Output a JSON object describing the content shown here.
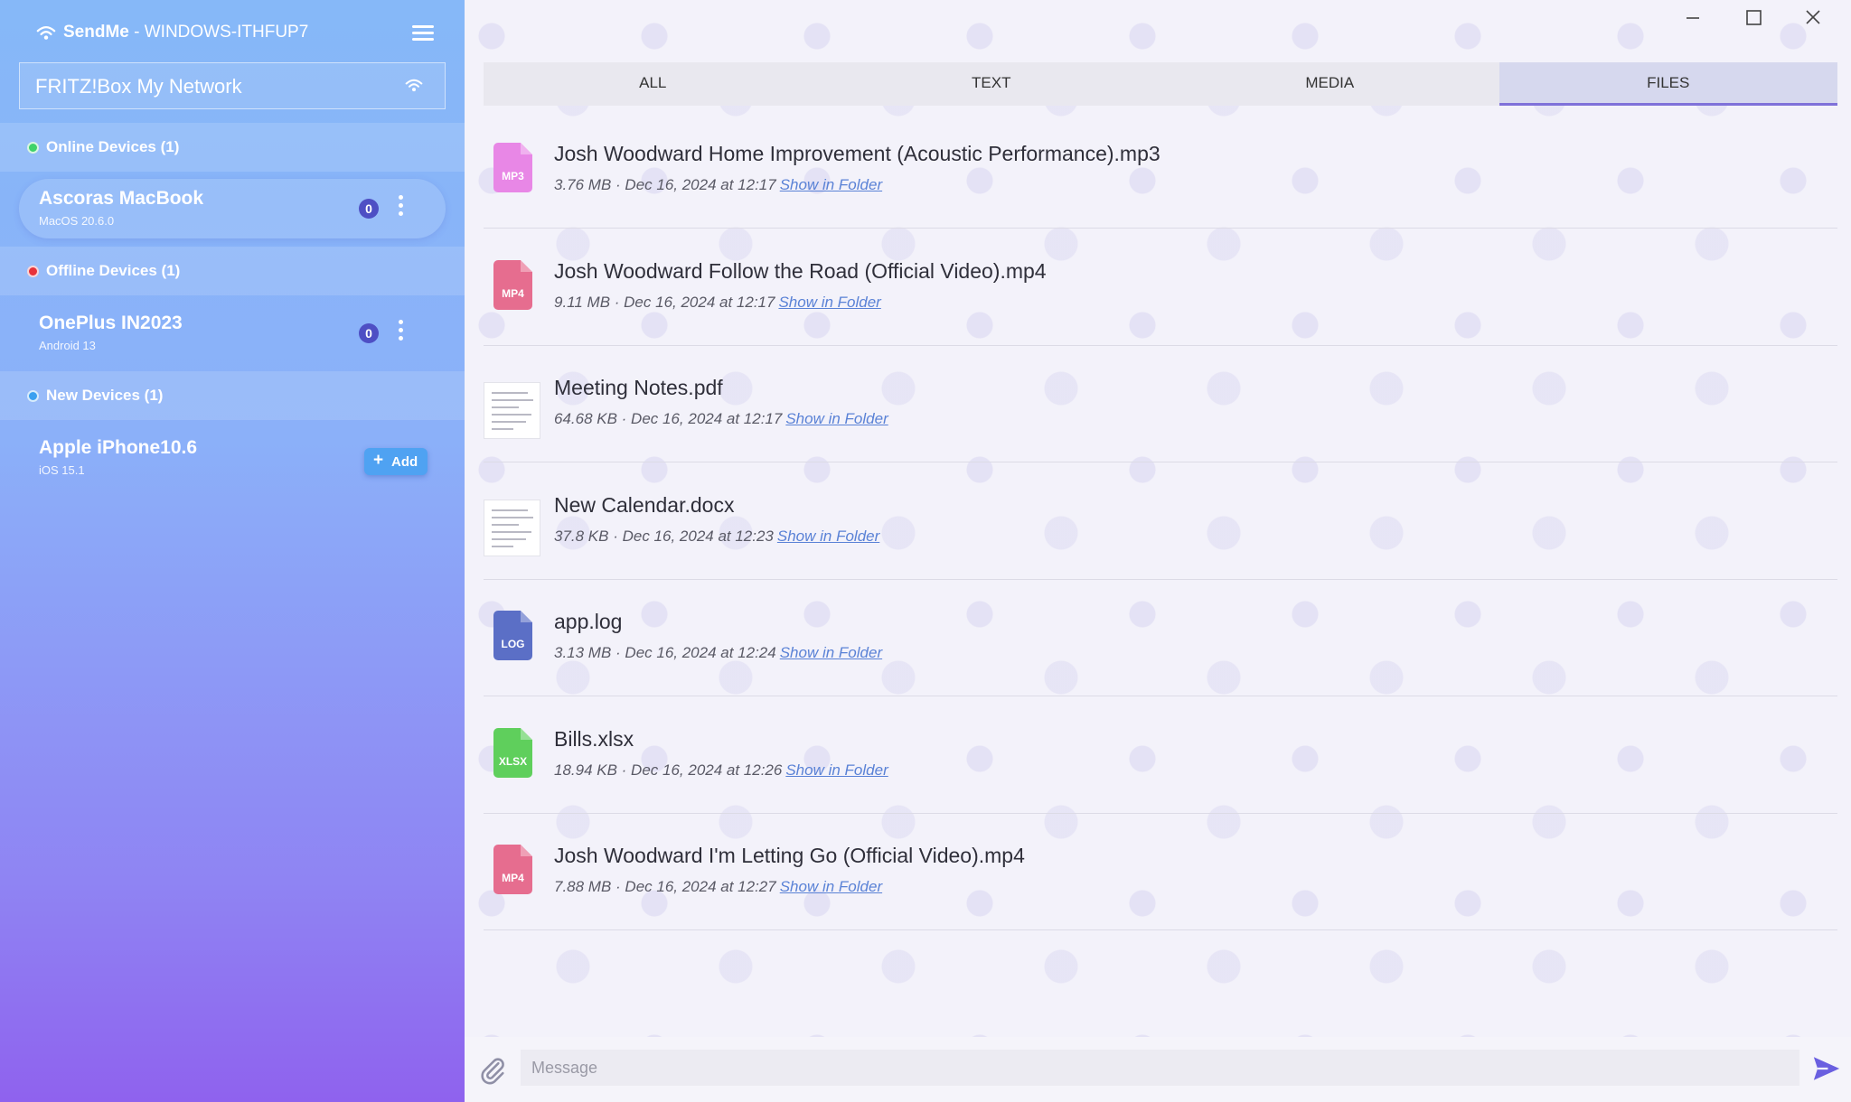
{
  "app": {
    "name": "SendMe",
    "separator": " - ",
    "host": "WINDOWS-ITHFUP7"
  },
  "network": {
    "name": "FRITZ!Box My Network"
  },
  "sections": {
    "online": {
      "label": "Online Devices (1)",
      "color": "#3ed36a"
    },
    "offline": {
      "label": "Offline Devices (1)",
      "color": "#e8323a"
    },
    "new": {
      "label": "New Devices (1)",
      "color": "#3aa0f0"
    }
  },
  "devices": {
    "online": [
      {
        "name": "Ascoras MacBook",
        "os": "MacOS 20.6.0",
        "badge": "0"
      }
    ],
    "offline": [
      {
        "name": "OnePlus IN2023",
        "os": "Android 13",
        "badge": "0"
      }
    ],
    "new": [
      {
        "name": "Apple iPhone10.6",
        "os": "iOS 15.1",
        "add_label": "Add"
      }
    ]
  },
  "tabs": [
    "ALL",
    "TEXT",
    "MEDIA",
    "FILES"
  ],
  "active_tab": "FILES",
  "show_in_folder": "Show in Folder",
  "files": [
    {
      "name": "Josh Woodward Home Improvement (Acoustic Performance).mp3",
      "meta": "3.76 MB · Dec 16, 2024 at 12:17",
      "ext": "MP3",
      "icon_color": "#e887e6"
    },
    {
      "name": "Josh Woodward Follow the Road (Official Video).mp4",
      "meta": "9.11 MB · Dec 16, 2024 at 12:17",
      "ext": "MP4",
      "icon_color": "#e66d8f"
    },
    {
      "name": "Meeting Notes.pdf",
      "meta": "64.68 KB · Dec 16, 2024 at 12:17",
      "ext": "PDF",
      "thumbnail": true
    },
    {
      "name": "New Calendar.docx",
      "meta": "37.8 KB · Dec 16, 2024 at 12:23",
      "ext": "DOCX",
      "thumbnail": true
    },
    {
      "name": "app.log",
      "meta": "3.13 MB · Dec 16, 2024 at 12:24",
      "ext": "LOG",
      "icon_color": "#5b6fc6"
    },
    {
      "name": "Bills.xlsx",
      "meta": "18.94 KB · Dec 16, 2024 at 12:26",
      "ext": "XLSX",
      "icon_color": "#5fcf5c"
    },
    {
      "name": "Josh Woodward I'm Letting Go (Official Video).mp4",
      "meta": "7.88 MB · Dec 16, 2024 at 12:27",
      "ext": "MP4",
      "icon_color": "#e66d8f"
    }
  ],
  "composer": {
    "placeholder": "Message"
  },
  "colors": {
    "accent": "#7f71d9",
    "send": "#6a5fe0",
    "link": "#5a82d6"
  }
}
